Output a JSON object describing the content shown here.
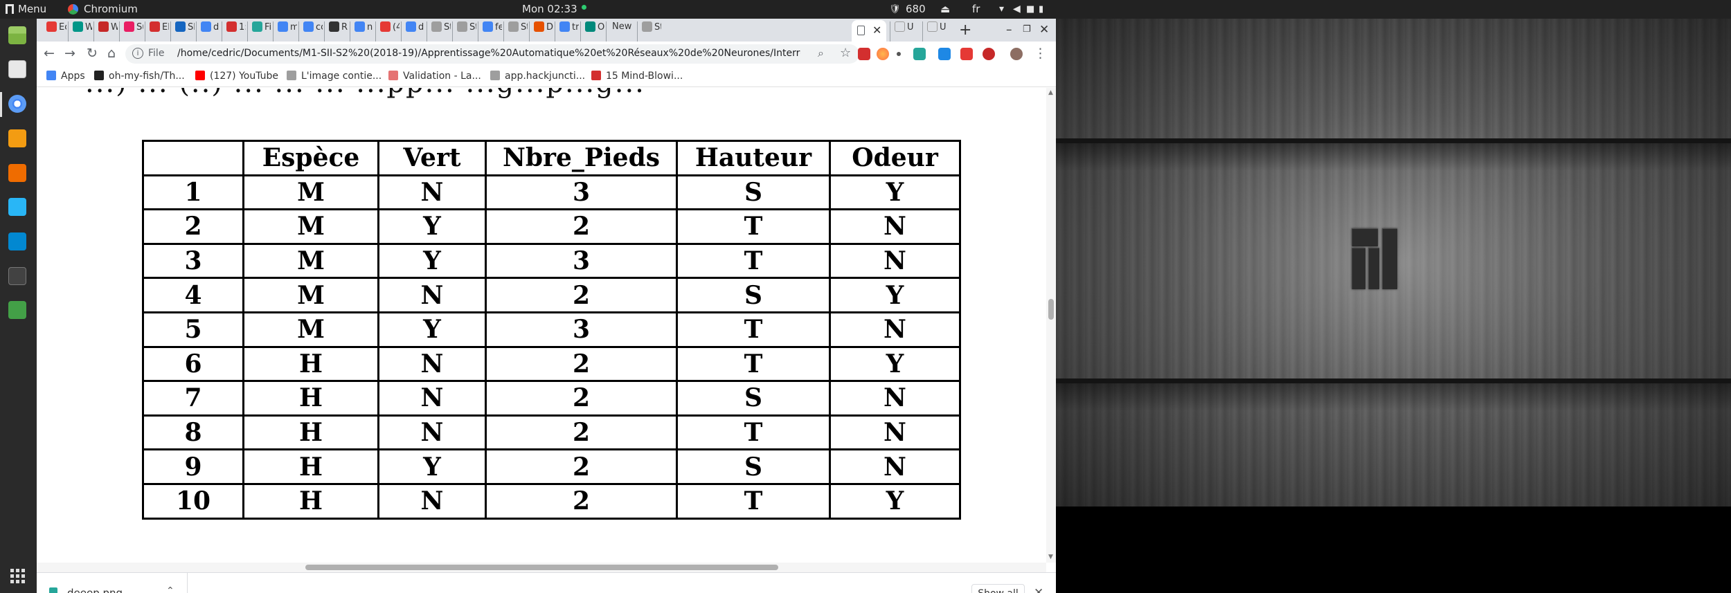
{
  "top_panel": {
    "menu_label": "Menu",
    "app_label": "Chromium",
    "clock": "Mon 02:33",
    "tray_count": "680",
    "keyboard_layout": "fr"
  },
  "dock": {
    "items": [
      "file-manager",
      "pdf-viewer",
      "chromium",
      "sublime-text",
      "download-manager",
      "chat-app",
      "virtual-machine",
      "terminal",
      "spreadsheet"
    ]
  },
  "browser": {
    "tabs": [
      {
        "label": "Ec",
        "color": "#e53935"
      },
      {
        "label": "W",
        "color": "#009688"
      },
      {
        "label": "W",
        "color": "#c62828"
      },
      {
        "label": "Su",
        "color": "#e91e63"
      },
      {
        "label": "El",
        "color": "#d32f2f"
      },
      {
        "label": "Sl",
        "color": "#1565c0"
      },
      {
        "label": "d",
        "color": "#4285f4"
      },
      {
        "label": "1:",
        "color": "#d32f2f"
      },
      {
        "label": "Fi",
        "color": "#26a69a"
      },
      {
        "label": "m",
        "color": "#4285f4"
      },
      {
        "label": "cc",
        "color": "#4285f4"
      },
      {
        "label": "R",
        "color": "#333333"
      },
      {
        "label": "n",
        "color": "#4285f4"
      },
      {
        "label": "(4",
        "color": "#e53935"
      },
      {
        "label": "d",
        "color": "#4285f4"
      },
      {
        "label": "St",
        "color": "#9e9e9e"
      },
      {
        "label": "St",
        "color": "#9e9e9e"
      },
      {
        "label": "fe",
        "color": "#4285f4"
      },
      {
        "label": "St",
        "color": "#9e9e9e"
      },
      {
        "label": "D",
        "color": "#e65100"
      },
      {
        "label": "tr",
        "color": "#4285f4"
      },
      {
        "label": "O",
        "color": "#00897b"
      },
      {
        "label": "New",
        "color": ""
      },
      {
        "label": "St",
        "color": "#9e9e9e"
      }
    ],
    "tabs_after_active": [
      {
        "label": "U",
        "color": "#9e9e9e"
      },
      {
        "label": "U",
        "color": "#9e9e9e"
      }
    ],
    "omnibox": {
      "scheme_label": "File",
      "url": "/home/cedric/Documents/M1-SII-S2%20(2018-19)/Apprentissage%20Automatique%20et%20Réseaux%20de%20Neurones/Interrogations%..."
    },
    "bookmarks": [
      {
        "label": "Apps",
        "color": "#4285f4"
      },
      {
        "label": "oh-my-fish/Th...",
        "color": "#222222"
      },
      {
        "label": "(127) YouTube",
        "color": "#ff0000"
      },
      {
        "label": "L'image contie...",
        "color": "#9e9e9e"
      },
      {
        "label": "Validation - La...",
        "color": "#e57373"
      },
      {
        "label": "app.hackjuncti...",
        "color": "#9e9e9e"
      },
      {
        "label": "15 Mind-Blowi...",
        "color": "#d32f2f"
      }
    ]
  },
  "page": {
    "partial_line": "...) ... (..) ... ... ... ...pp... ...g...p...g...",
    "table": {
      "headers": [
        "",
        "Espèce",
        "Vert",
        "Nbre_Pieds",
        "Hauteur",
        "Odeur"
      ],
      "rows": [
        [
          "1",
          "M",
          "N",
          "3",
          "S",
          "Y"
        ],
        [
          "2",
          "M",
          "Y",
          "2",
          "T",
          "N"
        ],
        [
          "3",
          "M",
          "Y",
          "3",
          "T",
          "N"
        ],
        [
          "4",
          "M",
          "N",
          "2",
          "S",
          "Y"
        ],
        [
          "5",
          "M",
          "Y",
          "3",
          "T",
          "N"
        ],
        [
          "6",
          "H",
          "N",
          "2",
          "T",
          "Y"
        ],
        [
          "7",
          "H",
          "N",
          "2",
          "S",
          "N"
        ],
        [
          "8",
          "H",
          "N",
          "2",
          "T",
          "N"
        ],
        [
          "9",
          "H",
          "Y",
          "2",
          "S",
          "N"
        ],
        [
          "10",
          "H",
          "N",
          "2",
          "T",
          "Y"
        ]
      ]
    }
  },
  "downloads": {
    "filename": "deeep.png",
    "show_all_label": "Show all"
  }
}
